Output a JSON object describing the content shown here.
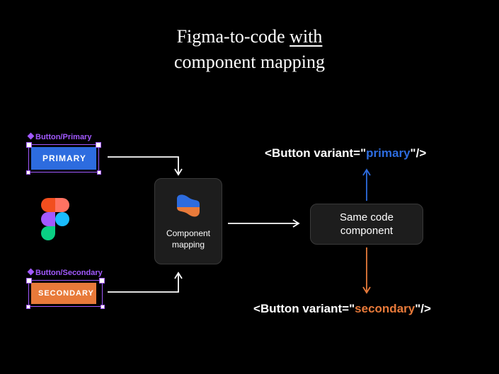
{
  "title": {
    "line1_pre": "Figma-to-code ",
    "line1_underlined": "with",
    "line2": "component mapping"
  },
  "buttons": {
    "primary": {
      "componentLabel": "Button/Primary",
      "text": "PRIMARY"
    },
    "secondary": {
      "componentLabel": "Button/Secondary",
      "text": "SECONDARY"
    }
  },
  "componentMapping": {
    "label": "Component\nmapping"
  },
  "sameCode": {
    "label": "Same code\ncomponent"
  },
  "code": {
    "open": "<",
    "tag": "Button ",
    "attr": "variant=",
    "q": "\"",
    "primaryVal": "primary",
    "secondaryVal": "secondary",
    "close": "/>"
  },
  "colors": {
    "primary": "#2d6cdf",
    "secondary": "#e87a3a",
    "figmaPurple": "#a259ff"
  }
}
